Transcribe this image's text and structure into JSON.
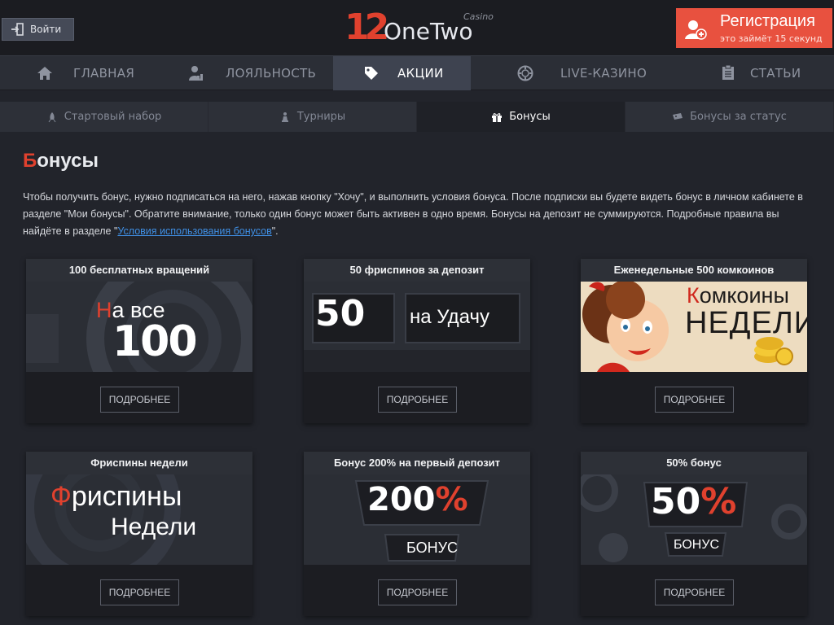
{
  "header": {
    "login_label": "Войти",
    "logo_number": "12",
    "logo_word_1": "One",
    "logo_word_2": "Two",
    "logo_casino": "Casino",
    "register_label": "Регистрация",
    "register_sub": "это займёт 15 секунд"
  },
  "mainnav": [
    {
      "label": "ГЛАВНАЯ",
      "icon": "home-icon"
    },
    {
      "label": "ЛОЯЛЬНОСТЬ",
      "icon": "loyalty-icon"
    },
    {
      "label": "АКЦИИ",
      "icon": "tag-icon",
      "active": true
    },
    {
      "label": "LIVE-КАЗИНО",
      "icon": "chip-icon"
    },
    {
      "label": "СТАТЬИ",
      "icon": "clipboard-icon"
    }
  ],
  "subnav": [
    {
      "label": "Стартовый набор",
      "icon": "rocket-icon"
    },
    {
      "label": "Турниры",
      "icon": "chess-icon"
    },
    {
      "label": "Бонусы",
      "icon": "gift-icon",
      "active": true
    },
    {
      "label": "Бонусы за статус",
      "icon": "ticket-icon"
    }
  ],
  "page": {
    "title_first": "Б",
    "title_rest": "онусы",
    "intro_1": "Чтобы получить бонус, нужно подписаться на него, нажав кнопку \"Хочу\", и выполнить условия бонуса. После подписки вы будете видеть бонус в личном кабинете в разделе \"Мои бонусы\". Обратите внимание, только один бонус может быть активен в одно время. Бонусы на депозит не суммируются. Подробные правила вы найдёте в разделе \"",
    "intro_link": "Условия использования бонусов",
    "intro_2": "\"."
  },
  "cards": [
    {
      "title": "100 бесплатных вращений",
      "b1": "На все",
      "b1_first": "Н",
      "b1_rest": "а все",
      "b2": "100",
      "more": "ПОДРОБНЕЕ"
    },
    {
      "title": "50 фриспинов за депозит",
      "b1": "50",
      "b2": "на Удачу",
      "more": "ПОДРОБНЕЕ"
    },
    {
      "title": "Еженедельные 500 комкоинов",
      "b1_first": "К",
      "b1_rest": "омкоины",
      "b2": "НЕДЕЛИ",
      "more": "ПОДРОБНЕЕ"
    },
    {
      "title": "Фриспины недели",
      "b1_first": "Ф",
      "b1_rest": "риспины",
      "b2": "Недели",
      "more": "ПОДРОБНЕЕ"
    },
    {
      "title": "Бонус 200% на первый депозит",
      "b1": "200",
      "b1_pct": "%",
      "b2": "БОНУС",
      "more": "ПОДРОБНЕЕ"
    },
    {
      "title": "50% бонус",
      "b1": "50",
      "b1_pct": "%",
      "b2": "БОНУС",
      "more": "ПОДРОБНЕЕ"
    }
  ],
  "colors": {
    "accent": "#e0412e",
    "register_bg": "#e8513f",
    "link": "#3f8fe4",
    "nav_active": "#3e4350"
  }
}
